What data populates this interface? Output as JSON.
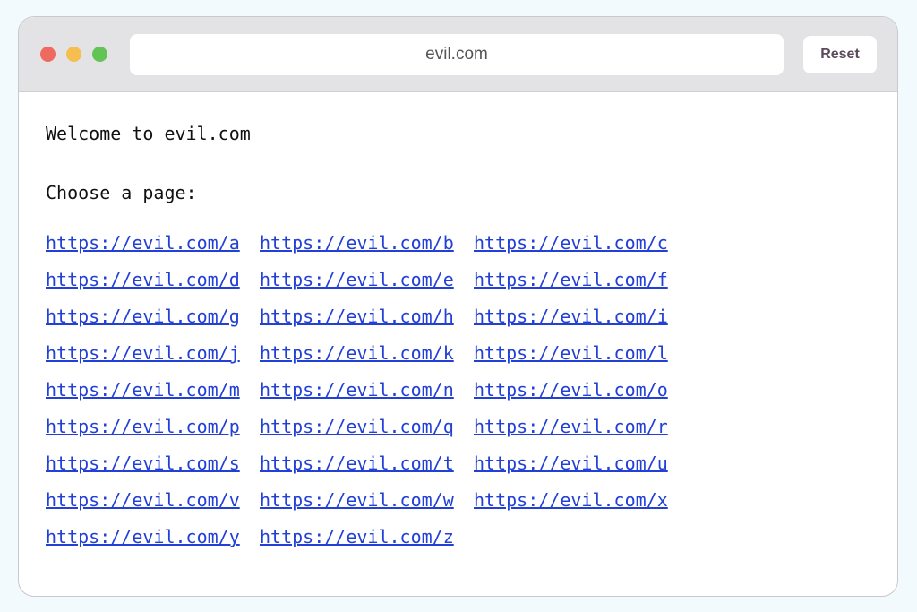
{
  "browser": {
    "url": "evil.com",
    "reset_label": "Reset"
  },
  "page": {
    "welcome": "Welcome to evil.com",
    "choose": "Choose a page:",
    "links": [
      "https://evil.com/a",
      "https://evil.com/b",
      "https://evil.com/c",
      "https://evil.com/d",
      "https://evil.com/e",
      "https://evil.com/f",
      "https://evil.com/g",
      "https://evil.com/h",
      "https://evil.com/i",
      "https://evil.com/j",
      "https://evil.com/k",
      "https://evil.com/l",
      "https://evil.com/m",
      "https://evil.com/n",
      "https://evil.com/o",
      "https://evil.com/p",
      "https://evil.com/q",
      "https://evil.com/r",
      "https://evil.com/s",
      "https://evil.com/t",
      "https://evil.com/u",
      "https://evil.com/v",
      "https://evil.com/w",
      "https://evil.com/x",
      "https://evil.com/y",
      "https://evil.com/z"
    ]
  },
  "colors": {
    "link": "#2240d6",
    "titlebar": "#e3e3e6",
    "close_dot": "#ee6a5e",
    "minimize_dot": "#f5be4f",
    "maximize_dot": "#61c454"
  }
}
